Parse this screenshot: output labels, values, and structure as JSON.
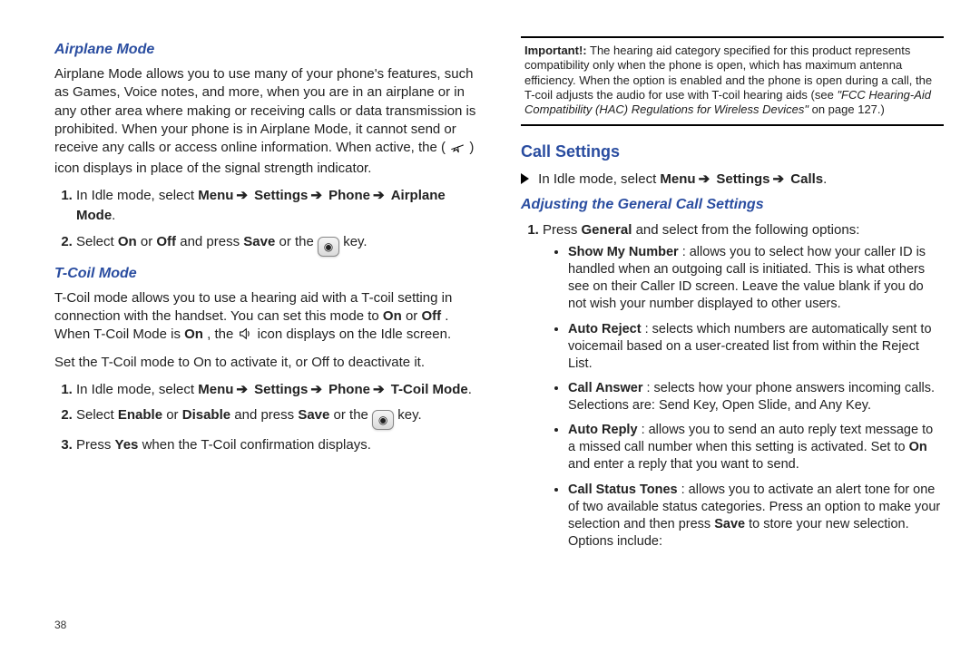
{
  "page_number": "38",
  "left": {
    "h_airplane": "Airplane Mode",
    "p_airplane_a": "Airplane Mode allows you to use many of your phone's features, such as Games, Voice notes, and more, when you are in an airplane or in any other area where making or receiving calls or data transmission is prohibited. When your phone is in Airplane Mode, it cannot send or receive any calls or access online information. When active, the (",
    "p_airplane_b": ") icon displays in place of the signal strength indicator.",
    "step_a1_pre": "In Idle mode, select ",
    "step_a1_menu": "Menu",
    "step_a1_settings": "Settings",
    "step_a1_phone": "Phone",
    "step_a1_airplane": "Airplane Mode",
    "step_a2_pre": "Select ",
    "step_a2_on": "On",
    "step_a2_or": " or ",
    "step_a2_off": "Off",
    "step_a2_mid": " and press ",
    "step_a2_save": "Save",
    "step_a2_post_a": " or the ",
    "step_a2_post_b": " key.",
    "h_tcoil": "T-Coil Mode",
    "p_tcoil_a": "T-Coil mode allows you to use a hearing aid with a T-coil setting in connection with the handset. You can set this mode to ",
    "p_tcoil_on": "On",
    "p_tcoil_b": " or ",
    "p_tcoil_off": "Off",
    "p_tcoil_c": ". When T-Coil Mode is ",
    "p_tcoil_on2": "On",
    "p_tcoil_d": ", the ",
    "p_tcoil_e": " icon displays on the Idle screen.",
    "p_tcoil_set": "Set the T-Coil mode to On to activate it, or Off to deactivate it.",
    "step_t1_pre": "In Idle mode, select ",
    "step_t1_menu": "Menu",
    "step_t1_settings": "Settings",
    "step_t1_phone": "Phone",
    "step_t1_tcoil": "T-Coil Mode",
    "step_t2_pre": "Select ",
    "step_t2_enable": "Enable",
    "step_t2_or": " or ",
    "step_t2_disable": "Disable",
    "step_t2_mid": " and press ",
    "step_t2_save": "Save",
    "step_t2_post_a": " or the ",
    "step_t2_post_b": " key.",
    "step_t3_pre": "Press ",
    "step_t3_yes": "Yes",
    "step_t3_post": " when the T-Coil confirmation displays."
  },
  "right": {
    "important_label": "Important!:",
    "important_body": " The hearing aid category specified for this product represents compatibility only when the phone is open, which has maximum antenna efficiency. When the option is enabled and the phone is open during a call, the T-coil adjusts the audio for use with T-coil hearing aids (see ",
    "important_italic": "\"FCC Hearing-Aid Compatibility (HAC) Regulations for Wireless Devices\"",
    "important_tail": " on page 127.)",
    "h_call": "Call Settings",
    "instr_pre": "In Idle mode, select ",
    "instr_menu": "Menu",
    "instr_settings": "Settings",
    "instr_calls": "Calls",
    "h_adjust": "Adjusting the General Call Settings",
    "step1_pre": "Press ",
    "step1_general": "General",
    "step1_post": " and select from the following options:",
    "b1_title": "Show My Number",
    "b1_body": ": allows you to select how your caller ID is handled when an outgoing call is initiated. This is what others see on their Caller ID screen. Leave the value blank if you do not wish your number displayed to other users.",
    "b2_title": "Auto Reject",
    "b2_body": ": selects which numbers are automatically sent to voicemail based on a user-created list from within the Reject List.",
    "b3_title": "Call Answer",
    "b3_body": ": selects how your phone answers incoming calls. Selections are: Send Key, Open Slide, and Any Key.",
    "b4_title": "Auto Reply",
    "b4_body_a": ": allows you to send an auto reply text message to a missed call number when this setting is activated. Set to ",
    "b4_on": "On",
    "b4_body_b": " and enter a reply that you want to send.",
    "b5_title": "Call Status Tones",
    "b5_body_a": ": allows you to activate an alert tone for one of two available status categories. Press an option to make your selection and then press ",
    "b5_save": "Save",
    "b5_body_b": " to store your new selection. Options include:"
  }
}
